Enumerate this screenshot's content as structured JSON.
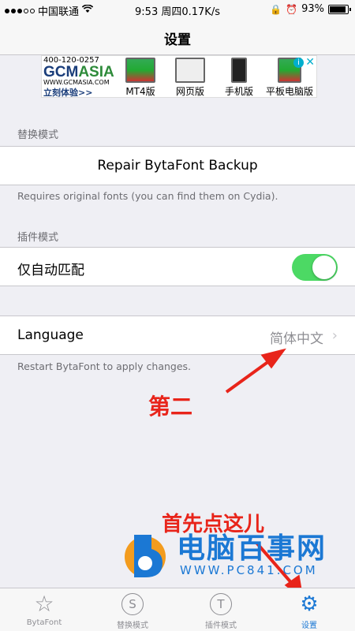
{
  "status_bar": {
    "carrier": "中国联通",
    "time": "9:53 周四",
    "speed": "0.17K/s",
    "battery": "93%",
    "battery_level": 0.93
  },
  "nav": {
    "title": "设置"
  },
  "ad": {
    "phone": "400-120-0257",
    "brand_prefix": "GCM",
    "brand_suffix": "ASIA",
    "url": "WWW.GCMASIA.COM",
    "cta": "立刻体验>>",
    "products": [
      "MT4版",
      "网页版",
      "手机版",
      "平板电脑版"
    ]
  },
  "replace_section": {
    "header": "替换模式",
    "action_label": "Repair BytaFont Backup",
    "footnote": "Requires original fonts (you can find them on Cydia)."
  },
  "plugin_section": {
    "header": "插件模式",
    "toggle_label": "仅自动匹配",
    "toggle_on": true
  },
  "language_section": {
    "label": "Language",
    "value": "简体中文",
    "footnote": "Restart BytaFont to apply changes."
  },
  "annotations": {
    "second": "第二",
    "first": "首先点这儿"
  },
  "watermark": {
    "name": "电脑百事网",
    "site": "WWW.PC841.COM"
  },
  "tabs": [
    {
      "label": "BytaFont",
      "icon": "star-icon",
      "glyph": "☆"
    },
    {
      "label": "替换模式",
      "icon": "s-circle-icon",
      "glyph": "S"
    },
    {
      "label": "插件模式",
      "icon": "t-circle-icon",
      "glyph": "T"
    },
    {
      "label": "设置",
      "icon": "gear-icon",
      "glyph": "⚙"
    }
  ],
  "colors": {
    "accent": "#1b78d4",
    "toggle_on": "#4cd964",
    "annotation": "#e8241a"
  }
}
